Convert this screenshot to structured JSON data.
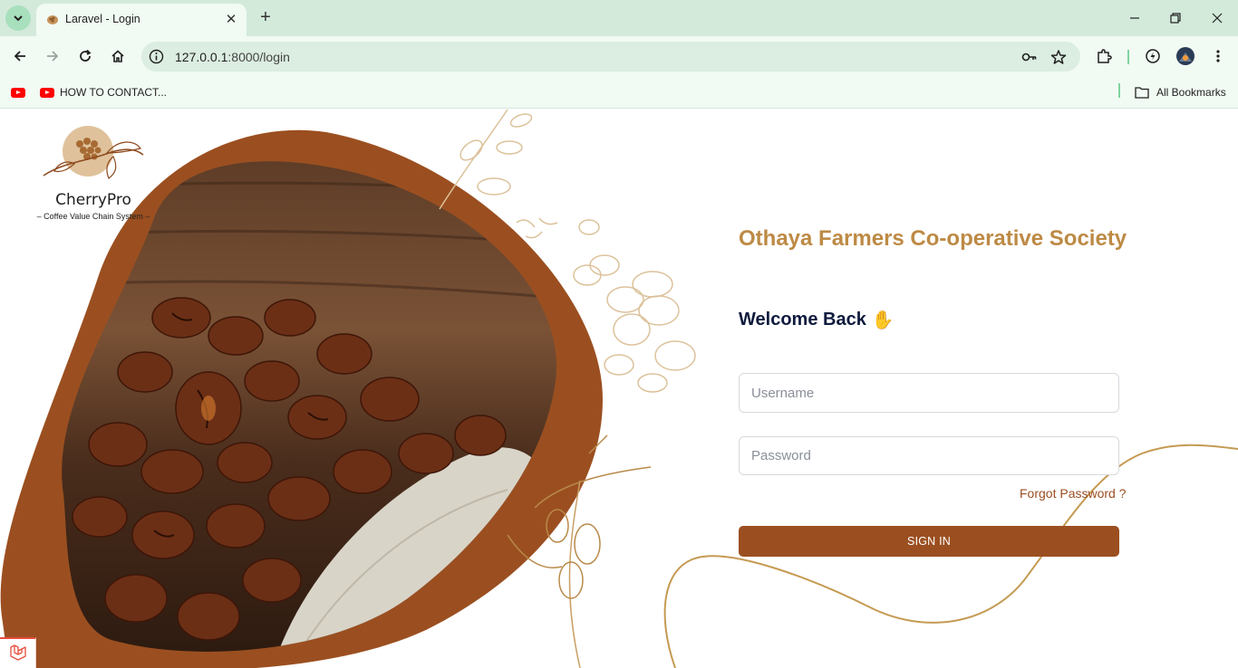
{
  "browser": {
    "tab_title": "Laravel - Login",
    "url_host": "127.0.0.1",
    "url_rest": ":8000/login",
    "bookmarks": [
      {
        "icon": "youtube-icon",
        "label": ""
      },
      {
        "icon": "youtube-icon",
        "label": "HOW TO CONTACT..."
      }
    ],
    "all_bookmarks_label": "All Bookmarks"
  },
  "brand": {
    "name": "CherryPro",
    "tagline": "– Coffee Value Chain System –"
  },
  "login": {
    "organization": "Othaya Farmers Co-operative Society",
    "welcome": "Welcome Back",
    "welcome_emoji": "✋",
    "username_placeholder": "Username",
    "password_placeholder": "Password",
    "forgot_label": "Forgot Password ?",
    "signin_label": "SIGN IN"
  },
  "colors": {
    "brand_brown": "#9b4f20",
    "gold": "#bd8a45",
    "heading_navy": "#0f1b3d",
    "chrome_green": "#d3eadb"
  }
}
